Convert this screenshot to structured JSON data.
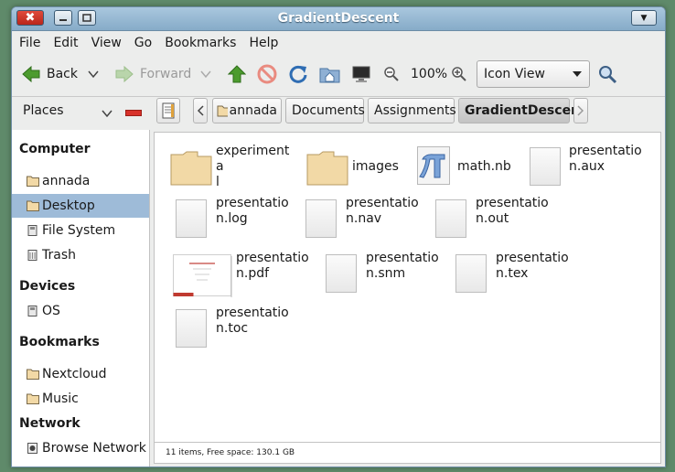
{
  "window": {
    "title": "GradientDescent",
    "close_glyph": "✖",
    "menu_glyph": "▼"
  },
  "menu": [
    "File",
    "Edit",
    "View",
    "Go",
    "Bookmarks",
    "Help"
  ],
  "toolbar": {
    "back": "Back",
    "forward": "Forward",
    "zoom": "100%",
    "view_mode": "Icon View",
    "dropdown_glyph": "⌵"
  },
  "location": {
    "places_label": "Places",
    "crumbs": [
      "annada",
      "Documents",
      "Assignments",
      "GradientDescent"
    ]
  },
  "sidebar": {
    "sections": [
      {
        "title": "Computer",
        "items": [
          {
            "label": "annada",
            "icon": "folder-icon"
          },
          {
            "label": "Desktop",
            "icon": "folder-icon",
            "selected": true
          },
          {
            "label": "File System",
            "icon": "drive-icon"
          },
          {
            "label": "Trash",
            "icon": "trash-icon"
          }
        ]
      },
      {
        "title": "Devices",
        "items": [
          {
            "label": "OS",
            "icon": "drive-icon"
          }
        ]
      },
      {
        "title": "Bookmarks",
        "items": [
          {
            "label": "Nextcloud",
            "icon": "folder-icon"
          },
          {
            "label": "Music",
            "icon": "folder-icon"
          }
        ]
      },
      {
        "title": "Network",
        "items": [
          {
            "label": "Browse Network",
            "icon": "network-icon"
          }
        ]
      }
    ]
  },
  "files": [
    {
      "line1": "experimenta",
      "line2": "l",
      "type": "folder"
    },
    {
      "line1": "images",
      "line2": "",
      "type": "folder"
    },
    {
      "line1": "math.nb",
      "line2": "",
      "type": "mathematica"
    },
    {
      "line1": "presentatio",
      "line2": "n.aux",
      "type": "doc"
    },
    {
      "line1": "presentatio",
      "line2": "n.log",
      "type": "doc"
    },
    {
      "line1": "presentatio",
      "line2": "n.nav",
      "type": "doc"
    },
    {
      "line1": "presentatio",
      "line2": "n.out",
      "type": "doc"
    },
    {
      "line1": "presentatio",
      "line2": "n.pdf",
      "type": "pdf"
    },
    {
      "line1": "presentatio",
      "line2": "n.snm",
      "type": "doc"
    },
    {
      "line1": "presentatio",
      "line2": "n.tex",
      "type": "doc"
    },
    {
      "line1": "presentatio",
      "line2": "n.toc",
      "type": "doc"
    }
  ],
  "status": "11 items, Free space: 130.1 GB",
  "colors": {
    "selection": "#9ebbd8",
    "titlebar": "#86abc8",
    "folder": "#f2d9a6",
    "close": "#c9301f"
  }
}
